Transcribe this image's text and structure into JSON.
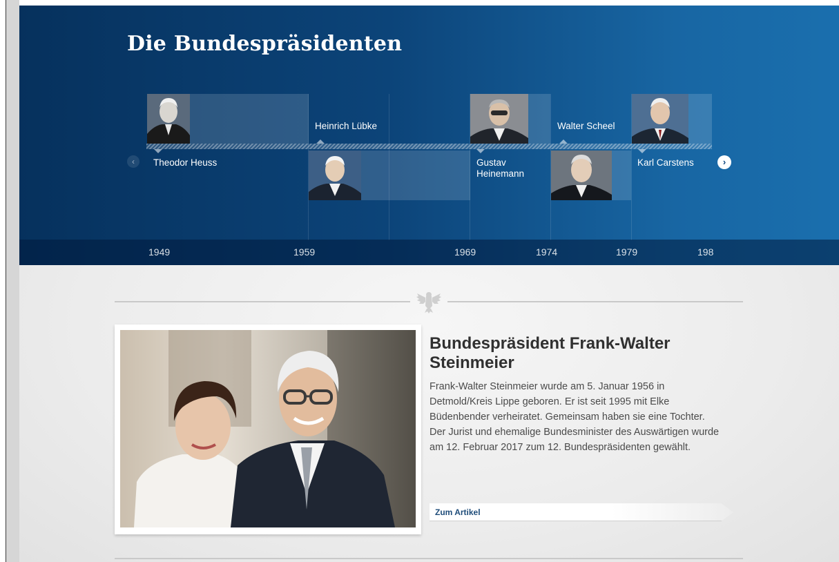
{
  "header": {
    "title": "Die Bundespräsidenten"
  },
  "timeline": {
    "presidents": [
      {
        "name": "Theodor Heuss"
      },
      {
        "name": "Heinrich Lübke"
      },
      {
        "name": "Gustav Heinemann"
      },
      {
        "name": "Walter Scheel"
      },
      {
        "name": "Karl Carstens"
      }
    ],
    "years": [
      "1949",
      "1959",
      "1969",
      "1974",
      "1979",
      "198"
    ]
  },
  "article": {
    "title": "Bundespräsident Frank-Walter Steinmeier",
    "text": "Frank-Walter Steinmeier wurde am 5. Januar 1956 in Detmold/Kreis Lippe geboren. Er ist seit 1995 mit Elke Büdenbender verheiratet. Gemeinsam haben sie eine Tochter. Der Jurist und ehemalige Bundesminister des Auswärtigen wurde am 12. Februar 2017 zum 12. Bundespräsidenten gewählt.",
    "link_label": "Zum Artikel"
  },
  "icons": {
    "prev": "chevron-left-icon",
    "next": "chevron-right-icon",
    "divider": "federal-eagle-icon"
  },
  "colors": {
    "header_dark": "#06315d",
    "header_light": "#1a6fae",
    "link": "#1f4d7a"
  }
}
